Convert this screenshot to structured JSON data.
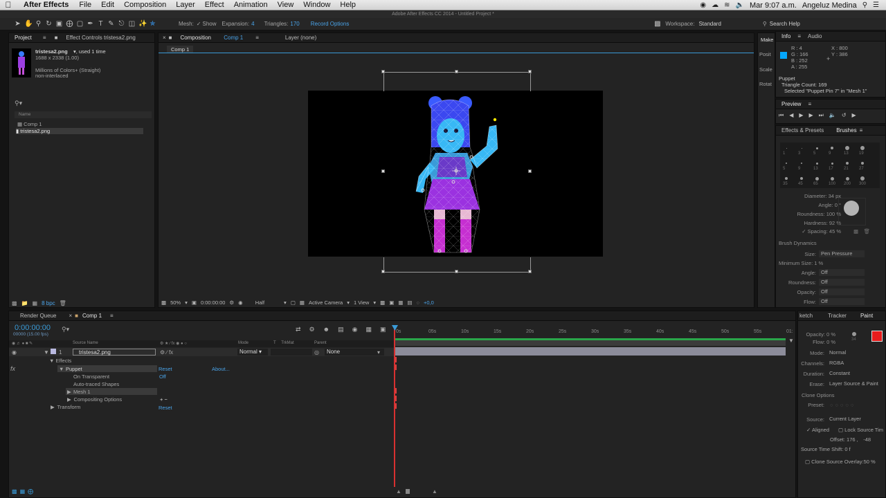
{
  "menubar": {
    "app": "After Effects",
    "items": [
      "File",
      "Edit",
      "Composition",
      "Layer",
      "Effect",
      "Animation",
      "View",
      "Window",
      "Help"
    ],
    "clock": "Mar 9:07 a.m.",
    "user": "Angeluz Medina"
  },
  "window_title": "Adobe After Effects CC 2014 - Untitled Project *",
  "toolbar": {
    "mesh_label": "Mesh:",
    "show_label": "Show",
    "expansion_label": "Expansion:",
    "expansion_value": "4",
    "triangles_label": "Triangles:",
    "triangles_value": "170",
    "record_options": "Record Options",
    "workspace_label": "Workspace:",
    "workspace_value": "Standard",
    "search_help": "Search Help"
  },
  "project": {
    "tab_project": "Project",
    "tab_effect_controls": "Effect Controls tristesa2.png",
    "file_name": "tristesa2.png",
    "used": ", used 1 time",
    "dimensions": "1688 x 2338 (1.00)",
    "colors": "Millions of Colors+ (Straight)",
    "interlace": "non-interlaced",
    "col_name": "Name",
    "items": [
      "Comp 1",
      "tristesa2.png"
    ],
    "bpc": "8 bpc"
  },
  "composition": {
    "tab": "Composition",
    "tab_comp": "Comp 1",
    "layer_tab": "Layer (none)",
    "breadcrumb": "Comp 1",
    "zoom": "50%",
    "timecode": "0:00:00:00",
    "resolution": "Half",
    "camera": "Active Camera",
    "views": "1 View",
    "exposure": "+0,0"
  },
  "info": {
    "tab_info": "Info",
    "tab_audio": "Audio",
    "r": "R : 4",
    "g": "G : 166",
    "b": "B : 252",
    "a": "A : 255",
    "x": "X : 800",
    "y": "Y : 386",
    "swatch": "#04a6fc",
    "line1": "Puppet",
    "line2": "Triangle Count: 169",
    "line3": "Selected \"Puppet Pin 7\" in \"Mesh 1\""
  },
  "preview": {
    "tab": "Preview"
  },
  "side_labels": [
    "Make",
    "Posit",
    "Scale",
    "Rotat"
  ],
  "brushes": {
    "tab_effects": "Effects & Presets",
    "tab_brushes": "Brushes",
    "sizes_row1": [
      "1",
      "3",
      "5",
      "9",
      "13",
      "19"
    ],
    "sizes_row2": [
      "5",
      "9",
      "13",
      "17",
      "21",
      "27"
    ],
    "sizes_row3": [
      "35",
      "45",
      "65",
      "100",
      "200",
      "300"
    ],
    "diameter": "Diameter: 34 px",
    "angle": "Angle: 0 °",
    "roundness": "Roundness: 100 %",
    "hardness": "Hardness: 92 %",
    "spacing": "Spacing: 45 %",
    "dynamics": "Brush Dynamics",
    "size_label": "Size:",
    "size_value": "Pen Pressure",
    "min_size": "Minimum Size: 1 %",
    "angle_label": "Angle:",
    "roundness_label": "Roundness:",
    "opacity_label": "Opacity:",
    "flow_label": "Flow:",
    "off": "Off"
  },
  "timeline": {
    "tab_render": "Render Queue",
    "tab_comp": "Comp 1",
    "timecode": "0:00:00:00",
    "fps": "00000 (15.00 fps)",
    "col_source": "Source Name",
    "col_mode": "Mode",
    "col_trk": "TrkMat",
    "col_parent": "Parent",
    "layer_num": "1",
    "layer_name": "tristesa2.png",
    "layer_mode": "Normal",
    "layer_parent": "None",
    "effects": "Effects",
    "puppet": "Puppet",
    "reset": "Reset",
    "about": "About...",
    "on_transparent": "On Transparent",
    "on_transparent_val": "Off",
    "auto_traced": "Auto-traced Shapes",
    "mesh": "Mesh 1",
    "compositing": "Compositing Options",
    "transform": "Transform",
    "ticks": [
      "0s",
      "05s",
      "10s",
      "15s",
      "20s",
      "25s",
      "30s",
      "35s",
      "40s",
      "45s",
      "50s",
      "55s",
      "01:"
    ]
  },
  "paint": {
    "tab_sketch": "ketch",
    "tab_tracker": "Tracker",
    "tab_paint": "Paint",
    "opacity": "Opacity: 0 %",
    "flow": "Flow: 0 %",
    "brush_size": "34",
    "mode_label": "Mode:",
    "mode_value": "Normal",
    "channels_label": "Channels:",
    "channels_value": "RGBA",
    "duration_label": "Duration:",
    "duration_value": "Constant",
    "erase_label": "Erase:",
    "erase_value": "Layer Source & Paint",
    "clone_options": "Clone Options",
    "preset_label": "Preset:",
    "source_label": "Source:",
    "source_value": "Current Layer",
    "aligned": "Aligned",
    "lock_source": "Lock Source Tim",
    "offset": "Offset: 176 ,",
    "offset_y": "-48",
    "time_shift": "Source Time Shift: 0 f",
    "overlay": "Clone Source Overlay:",
    "overlay_val": "50 %",
    "fg_color": "#e81c1c"
  }
}
